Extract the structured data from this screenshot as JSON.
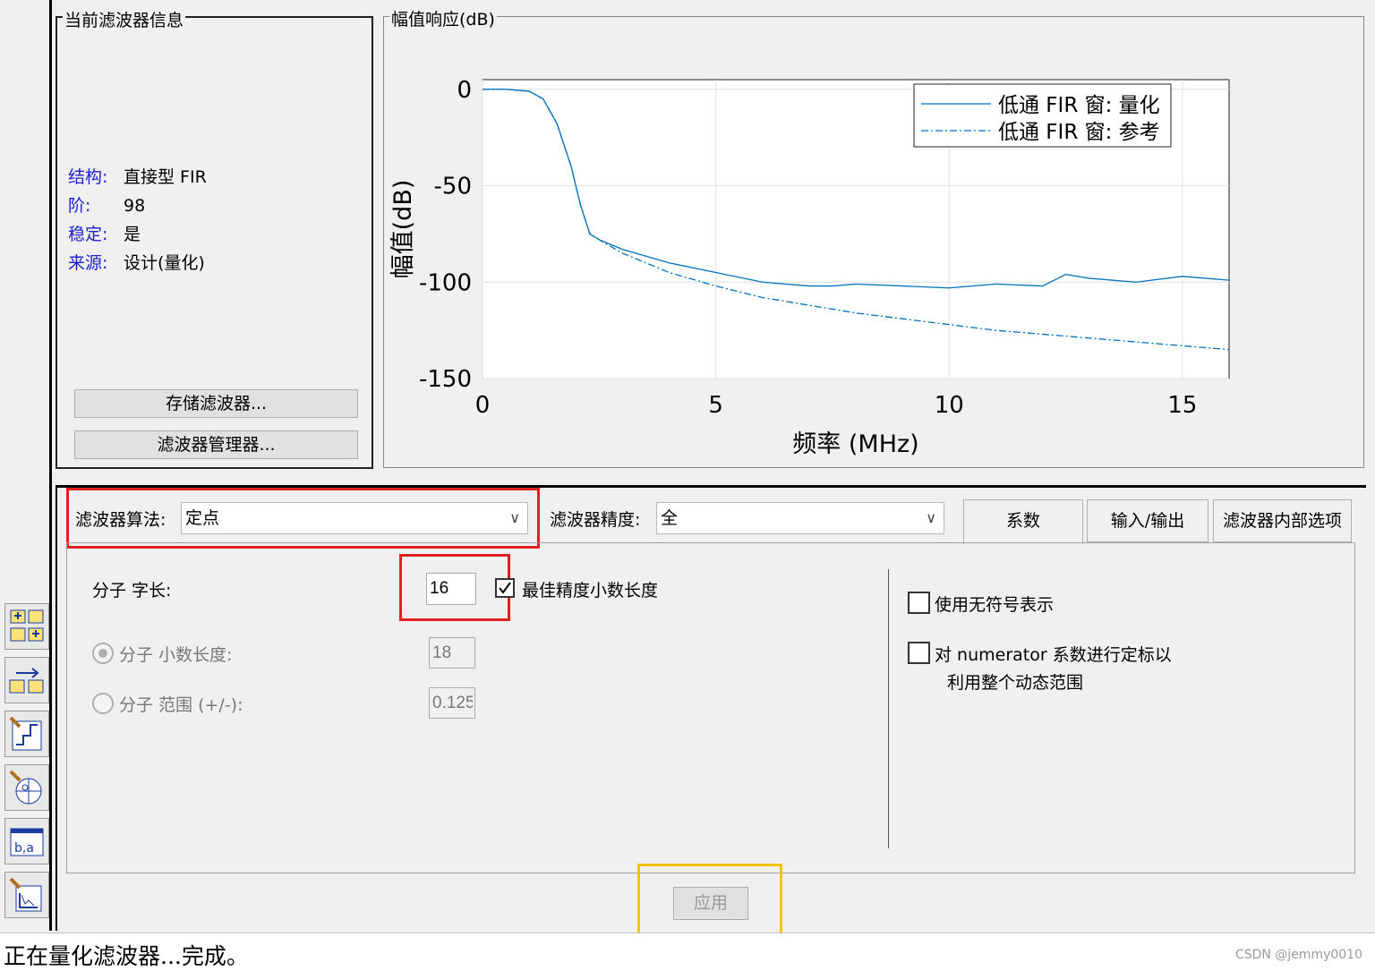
{
  "filter_info": {
    "title": "当前滤波器信息",
    "rows": [
      {
        "key": "结构:",
        "value": "直接型 FIR"
      },
      {
        "key": "阶:",
        "value": "98"
      },
      {
        "key": "稳定:",
        "value": "是"
      },
      {
        "key": "来源:",
        "value": "设计(量化)"
      }
    ],
    "store_button": "存储滤波器...",
    "manager_button": "滤波器管理器..."
  },
  "chart_panel_title": "幅值响应(dB)",
  "chart_data": {
    "type": "line",
    "xlabel": "频率 (MHz)",
    "ylabel": "幅值(dB)",
    "xlim": [
      0,
      16
    ],
    "ylim": [
      -150,
      5
    ],
    "xticks": [
      "0",
      "5",
      "10",
      "15"
    ],
    "yticks": [
      "0",
      "-50",
      "-100",
      "-150"
    ],
    "grid": true,
    "legend_position": "top-right",
    "series": [
      {
        "name": "低通 FIR 窗: 量化",
        "style": "solid",
        "color": "#0072bd",
        "x": [
          0,
          0.5,
          1.0,
          1.3,
          1.6,
          1.9,
          2.1,
          2.3,
          2.5,
          3,
          4,
          5,
          6,
          7,
          7.5,
          8,
          9,
          10,
          11,
          12,
          12.5,
          13,
          14,
          15,
          16
        ],
        "y": [
          0,
          0,
          -1,
          -5,
          -18,
          -40,
          -60,
          -75,
          -78,
          -83,
          -90,
          -95,
          -100,
          -102,
          -102,
          -101,
          -102,
          -103,
          -101,
          -102,
          -96,
          -98,
          -100,
          -97,
          -99
        ]
      },
      {
        "name": "低通 FIR 窗: 参考",
        "style": "dashdot",
        "color": "#0072bd",
        "x": [
          0,
          0.5,
          1.0,
          1.3,
          1.6,
          1.9,
          2.1,
          2.3,
          2.5,
          3,
          4,
          5,
          6,
          7,
          8,
          9,
          10,
          11,
          12,
          13,
          14,
          15,
          16
        ],
        "y": [
          0,
          0,
          -1,
          -5,
          -18,
          -40,
          -60,
          -75,
          -78,
          -85,
          -95,
          -102,
          -108,
          -112,
          -116,
          -119,
          -122,
          -125,
          -127,
          -129,
          -131,
          -133,
          -135
        ]
      }
    ]
  },
  "settings": {
    "algorithm_label": "滤波器算法:",
    "algorithm_value": "定点",
    "precision_label": "滤波器精度:",
    "precision_value": "全",
    "tabs": [
      "系数",
      "输入/输出",
      "滤波器内部选项"
    ],
    "numerator_wordlength_label": "分子 字长:",
    "numerator_wordlength_value": "16",
    "best_precision_label": "最佳精度小数长度",
    "best_precision_checked": true,
    "frac_length_label": "分子 小数长度:",
    "frac_length_value": "18",
    "range_label": "分子 范围 (+/-):",
    "range_value": "0.125",
    "unsigned_label": "使用无符号表示",
    "scale_label_line1": "对 numerator 系数进行定标以",
    "scale_label_line2": "利用整个动态范围",
    "apply_button": "应用"
  },
  "status_text": "正在量化滤波器...完成。",
  "watermark": "CSDN @jemmy0010",
  "colors": {
    "highlight_red": "#e02020",
    "highlight_yellow": "#f5c400",
    "info_key": "#2020d0",
    "line": "#0072bd"
  }
}
